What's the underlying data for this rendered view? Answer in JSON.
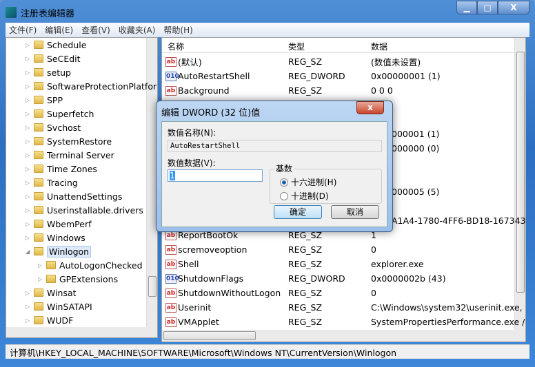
{
  "window": {
    "title": "注册表编辑器",
    "min": "▁",
    "max": "□",
    "close": "X"
  },
  "menu": [
    "文件(F)",
    "编辑(E)",
    "查看(V)",
    "收藏夹(A)",
    "帮助(H)"
  ],
  "tree": [
    {
      "label": "Schedule",
      "level": 0
    },
    {
      "label": "SeCEdit",
      "level": 0
    },
    {
      "label": "setup",
      "level": 0
    },
    {
      "label": "SoftwareProtectionPlatform",
      "level": 0
    },
    {
      "label": "SPP",
      "level": 0
    },
    {
      "label": "Superfetch",
      "level": 0
    },
    {
      "label": "Svchost",
      "level": 0
    },
    {
      "label": "SystemRestore",
      "level": 0
    },
    {
      "label": "Terminal Server",
      "level": 0
    },
    {
      "label": "Time Zones",
      "level": 0
    },
    {
      "label": "Tracing",
      "level": 0
    },
    {
      "label": "UnattendSettings",
      "level": 0
    },
    {
      "label": "Userinstallable.drivers",
      "level": 0
    },
    {
      "label": "WbemPerf",
      "level": 0
    },
    {
      "label": "Windows",
      "level": 0
    },
    {
      "label": "Winlogon",
      "level": 0,
      "expanded": true,
      "selected": true
    },
    {
      "label": "AutoLogonChecked",
      "level": 1
    },
    {
      "label": "GPExtensions",
      "level": 1
    },
    {
      "label": "Winsat",
      "level": 0
    },
    {
      "label": "WinSATAPI",
      "level": 0
    },
    {
      "label": "WUDF",
      "level": 0
    }
  ],
  "list": {
    "headers": [
      "名称",
      "类型",
      "数据"
    ],
    "rows": [
      {
        "icon": "ab",
        "name": "(默认)",
        "type": "REG_SZ",
        "data": "(数值未设置)"
      },
      {
        "icon": "dw",
        "name": "AutoRestartShell",
        "type": "REG_DWORD",
        "data": "0x00000001 (1)"
      },
      {
        "icon": "ab",
        "name": "Background",
        "type": "REG_SZ",
        "data": "0 0 0"
      },
      {
        "icon": "",
        "name": "",
        "type": "",
        "data": ""
      },
      {
        "icon": "",
        "name": "",
        "type": "",
        "data": ""
      },
      {
        "icon": "",
        "name": "",
        "type": "",
        "data": "000001 (1)",
        "frag": true
      },
      {
        "icon": "",
        "name": "",
        "type": "",
        "data": "000000 (0)",
        "frag": true
      },
      {
        "icon": "",
        "name": "",
        "type": "",
        "data": ""
      },
      {
        "icon": "",
        "name": "",
        "type": "",
        "data": ""
      },
      {
        "icon": "",
        "name": "",
        "type": "",
        "data": "000005 (5)",
        "frag": true
      },
      {
        "icon": "",
        "name": "",
        "type": "",
        "data": ""
      },
      {
        "icon": "",
        "name": "",
        "type": "",
        "data": "A1A4-1780-4FF6-BD18-167343",
        "frag": true
      },
      {
        "icon": "ab",
        "name": "ReportBootOk",
        "type": "REG_SZ",
        "data": "1"
      },
      {
        "icon": "ab",
        "name": "scremoveoption",
        "type": "REG_SZ",
        "data": "0"
      },
      {
        "icon": "ab",
        "name": "Shell",
        "type": "REG_SZ",
        "data": "explorer.exe"
      },
      {
        "icon": "dw",
        "name": "ShutdownFlags",
        "type": "REG_DWORD",
        "data": "0x0000002b (43)"
      },
      {
        "icon": "ab",
        "name": "ShutdownWithoutLogon",
        "type": "REG_SZ",
        "data": "0"
      },
      {
        "icon": "ab",
        "name": "Userinit",
        "type": "REG_SZ",
        "data": "C:\\Windows\\system32\\userinit.exe,"
      },
      {
        "icon": "ab",
        "name": "VMApplet",
        "type": "REG_SZ",
        "data": "SystemPropertiesPerformance.exe /"
      }
    ]
  },
  "status": "计算机\\HKEY_LOCAL_MACHINE\\SOFTWARE\\Microsoft\\Windows NT\\CurrentVersion\\Winlogon",
  "dialog": {
    "title": "编辑 DWORD (32 位)值",
    "close": "x",
    "name_label": "数值名称(N):",
    "name_value": "AutoRestartShell",
    "data_label": "数值数据(V):",
    "data_value": "1",
    "base_label": "基数",
    "hex_label": "十六进制(H)",
    "dec_label": "十进制(D)",
    "base_selected": "hex",
    "ok": "确定",
    "cancel": "取消"
  }
}
